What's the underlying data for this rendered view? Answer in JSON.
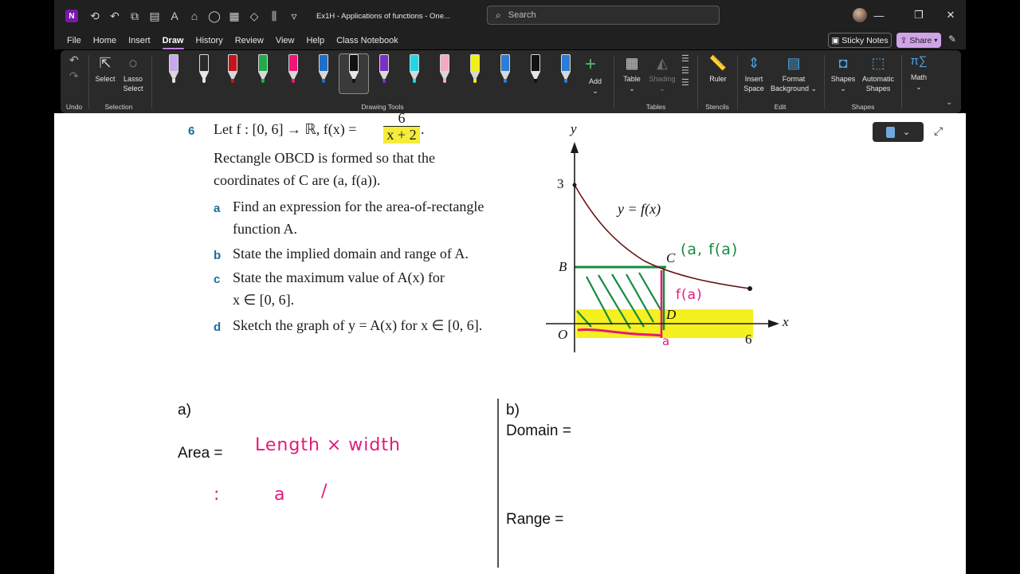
{
  "titlebar": {
    "doc_title": "Ex1H - Applications of functions  -  One...",
    "search_placeholder": "Search",
    "app_initial": "N"
  },
  "menu": {
    "items": [
      "File",
      "Home",
      "Insert",
      "Draw",
      "History",
      "Review",
      "View",
      "Help",
      "Class Notebook"
    ],
    "active": "Draw",
    "sticky_notes": "Sticky Notes",
    "share": "Share"
  },
  "ribbon": {
    "undo_group": "Undo",
    "select": "Select",
    "lasso_select_1": "Lasso",
    "lasso_select_2": "Select",
    "selection_group": "Selection",
    "add": "Add",
    "drawing_tools_group": "Drawing Tools",
    "table": "Table",
    "shading": "Shading",
    "tables_group": "Tables",
    "ruler": "Ruler",
    "stencils_group": "Stencils",
    "insert_space_1": "Insert",
    "insert_space_2": "Space",
    "format_bg_1": "Format",
    "format_bg_2": "Background",
    "edit_group": "Edit",
    "shapes": "Shapes",
    "auto_shapes_1": "Automatic",
    "auto_shapes_2": "Shapes",
    "shapes_group": "Shapes",
    "math": "Math",
    "pens": [
      {
        "color": "#c8a8e8",
        "tip": "#e5e5e5"
      },
      {
        "color": "#e8e8e8",
        "tip": "#e8e8e8"
      },
      {
        "color": "#c0161b",
        "tip": "#c0161b"
      },
      {
        "color": "#22a94b",
        "tip": "#22a94b"
      },
      {
        "color": "#f0157b",
        "tip": "#f0157b"
      },
      {
        "color": "#1f6ec8",
        "tip": "#1f6ec8"
      },
      {
        "color": "#111111",
        "tip": "#111111"
      },
      {
        "color": "#7b2fc4",
        "tip": "#7b2fc4"
      },
      {
        "color": "#21d6e6",
        "tip": "#21d6e6"
      },
      {
        "color": "#f5a9c9",
        "tip": "#f5a9c9"
      },
      {
        "color": "#f2ef12",
        "tip": "#f2ef12"
      },
      {
        "color": "#2a7fd4",
        "tip": "#2a7fd4"
      },
      {
        "color": "#111111",
        "tip": "#111111"
      },
      {
        "color": "#2a7fd4",
        "tip": "#2a7fd4"
      }
    ]
  },
  "question": {
    "number": "6",
    "line1_prefix": "Let f : [0, 6] → ℝ, f(x) = ",
    "frac_num": "6",
    "frac_den": "x + 2",
    "line2": "Rectangle OBCD is formed so that the",
    "line3": "coordinates of C are (a, f(a)).",
    "parts": [
      {
        "letter": "a",
        "text1": "Find an expression for the area-of-rectangle",
        "text2": "function A."
      },
      {
        "letter": "b",
        "text1": "State the implied domain and range of A.",
        "text2": ""
      },
      {
        "letter": "c",
        "text1": "State the maximum value of A(x) for",
        "text2": "x ∈ [0, 6]."
      },
      {
        "letter": "d",
        "text1": "Sketch the graph of y = A(x) for x ∈ [0, 6].",
        "text2": ""
      }
    ]
  },
  "graph": {
    "y_axis": "y",
    "x_axis": "x",
    "y_intercept": "3",
    "x_end": "6",
    "origin": "O",
    "point_b": "B",
    "point_c": "C",
    "point_d": "D",
    "curve_label": "y = f(x)",
    "ink_point": "(a, f(a)",
    "ink_height": "f(a)",
    "ink_base": "a"
  },
  "notes": {
    "part_a": "a)",
    "area_label": "Area =",
    "area_ink": "Length × width",
    "area_ink2_colon": ":",
    "area_ink2_a": "a",
    "area_ink2_stroke": "/",
    "part_b": "b)",
    "domain_label": "Domain =",
    "range_label": "Range ="
  }
}
